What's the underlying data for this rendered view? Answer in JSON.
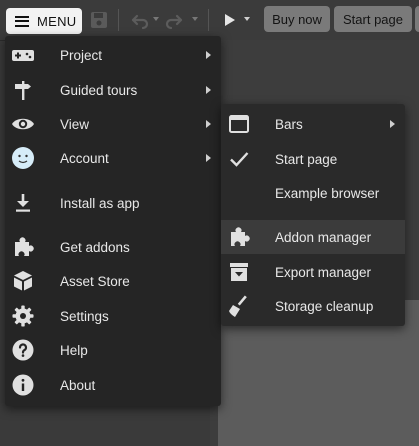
{
  "toolbar": {
    "menu_label": "MENU",
    "buy_now_label": "Buy now",
    "start_page_label": "Start page"
  },
  "main_menu": {
    "items": [
      {
        "label": "Project",
        "icon": "gamepad-icon",
        "has_submenu": true
      },
      {
        "label": "Guided tours",
        "icon": "signpost-icon",
        "has_submenu": true
      },
      {
        "label": "View",
        "icon": "eye-icon",
        "has_submenu": true
      },
      {
        "label": "Account",
        "icon": "avatar-icon",
        "has_submenu": true
      },
      {
        "label": "Install as app",
        "icon": "download-icon",
        "has_submenu": false
      },
      {
        "label": "Get addons",
        "icon": "puzzle-icon",
        "has_submenu": false
      },
      {
        "label": "Asset Store",
        "icon": "box-icon",
        "has_submenu": false
      },
      {
        "label": "Settings",
        "icon": "gear-icon",
        "has_submenu": false
      },
      {
        "label": "Help",
        "icon": "question-icon",
        "has_submenu": false
      },
      {
        "label": "About",
        "icon": "info-icon",
        "has_submenu": false
      }
    ]
  },
  "view_submenu": {
    "items": [
      {
        "label": "Bars",
        "icon": "window-icon",
        "has_submenu": true
      },
      {
        "label": "Start page",
        "icon": "checkmark-icon",
        "checked": true
      },
      {
        "label": "Example browser",
        "icon": ""
      },
      {
        "label": "Addon manager",
        "icon": "puzzle-icon",
        "highlighted": true
      },
      {
        "label": "Export manager",
        "icon": "export-box-icon"
      },
      {
        "label": "Storage cleanup",
        "icon": "broom-icon"
      }
    ]
  },
  "colors": {
    "menu_bg": "#252525",
    "submenu_bg": "#2a2a2a",
    "highlight": "#3b3b3b",
    "text": "#e8e8e8",
    "toolbar_button": "#7a7a7a"
  }
}
